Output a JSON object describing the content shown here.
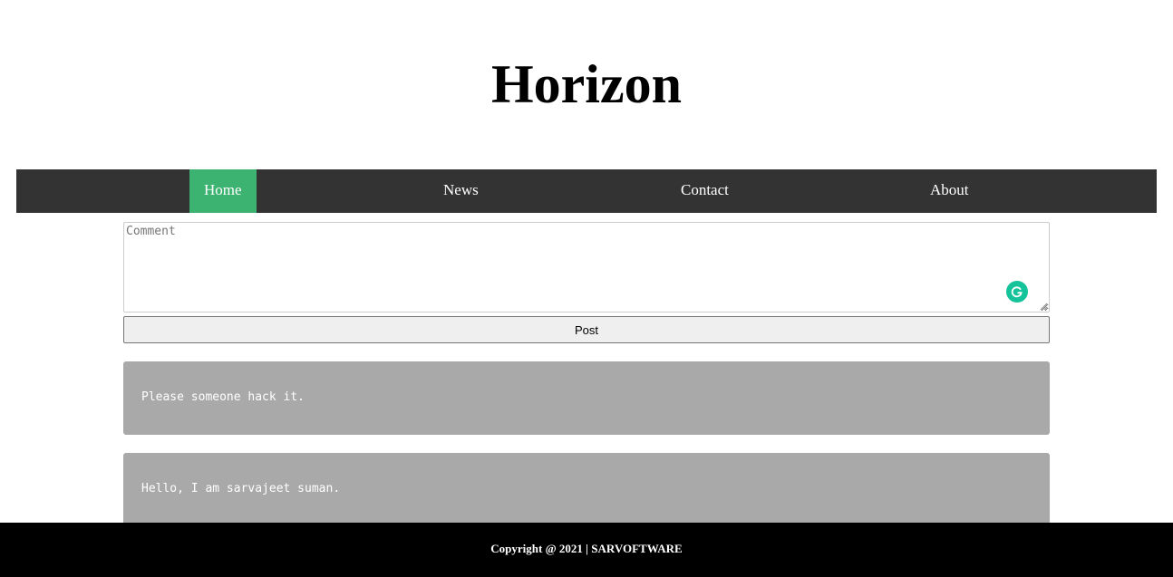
{
  "header": {
    "title": "Horizon"
  },
  "nav": {
    "items": [
      {
        "label": "Home",
        "active": true
      },
      {
        "label": "News",
        "active": false
      },
      {
        "label": "Contact",
        "active": false
      },
      {
        "label": "About",
        "active": false
      }
    ],
    "background_color": "#333333",
    "active_color": "#3cb371"
  },
  "comment_form": {
    "placeholder": "Comment",
    "value": "",
    "post_label": "Post",
    "grammar_icon": "grammarly-icon"
  },
  "posts": [
    {
      "text": "Please someone hack it."
    },
    {
      "text": "Hello, I am sarvajeet suman."
    }
  ],
  "footer": {
    "text": "Copyright @ 2021 | SARVOFTWARE"
  }
}
